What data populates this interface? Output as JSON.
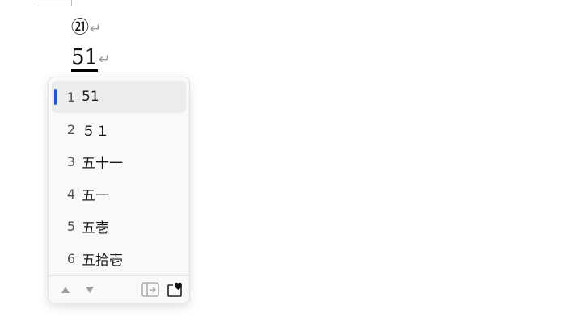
{
  "document": {
    "line1": "㉑",
    "line2_composing": "51",
    "paragraph_mark": "↵"
  },
  "ime": {
    "selected_index": 1,
    "accent_color": "#1d5fb8",
    "candidates": [
      {
        "num": "1",
        "text": "51"
      },
      {
        "num": "2",
        "text": "５１"
      },
      {
        "num": "3",
        "text": "五十一"
      },
      {
        "num": "4",
        "text": "五一"
      },
      {
        "num": "5",
        "text": "五壱"
      },
      {
        "num": "6",
        "text": "五拾壱"
      }
    ],
    "footer": {
      "prev_icon": "triangle-up-icon",
      "next_icon": "triangle-down-icon",
      "expand_icon": "expand-panel-icon",
      "favorite_icon": "heart-clipboard-icon"
    }
  }
}
